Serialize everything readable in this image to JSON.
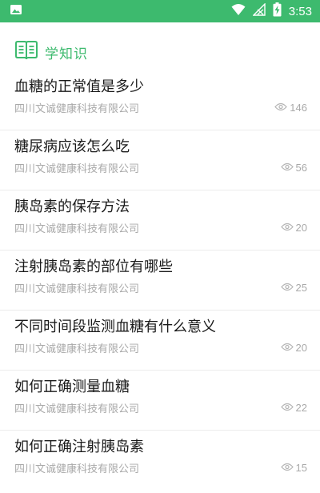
{
  "status_bar": {
    "time": "3:53",
    "icons": [
      "image-icon",
      "wifi-icon",
      "no-signal-icon",
      "battery-charging-icon"
    ],
    "color": "#3dba6e"
  },
  "section": {
    "title": "学知识",
    "icon": "book-icon",
    "accent": "#3dba6e"
  },
  "articles": [
    {
      "title": "血糖的正常值是多少",
      "source": "四川文诚健康科技有限公司",
      "views": "146"
    },
    {
      "title": "糖尿病应该怎么吃",
      "source": "四川文诚健康科技有限公司",
      "views": "56"
    },
    {
      "title": "胰岛素的保存方法",
      "source": "四川文诚健康科技有限公司",
      "views": "20"
    },
    {
      "title": "注射胰岛素的部位有哪些",
      "source": "四川文诚健康科技有限公司",
      "views": "25"
    },
    {
      "title": "不同时间段监测血糖有什么意义",
      "source": "四川文诚健康科技有限公司",
      "views": "20"
    },
    {
      "title": "如何正确测量血糖",
      "source": "四川文诚健康科技有限公司",
      "views": "22"
    },
    {
      "title": "如何正确注射胰岛素",
      "source": "四川文诚健康科技有限公司",
      "views": "15"
    }
  ]
}
